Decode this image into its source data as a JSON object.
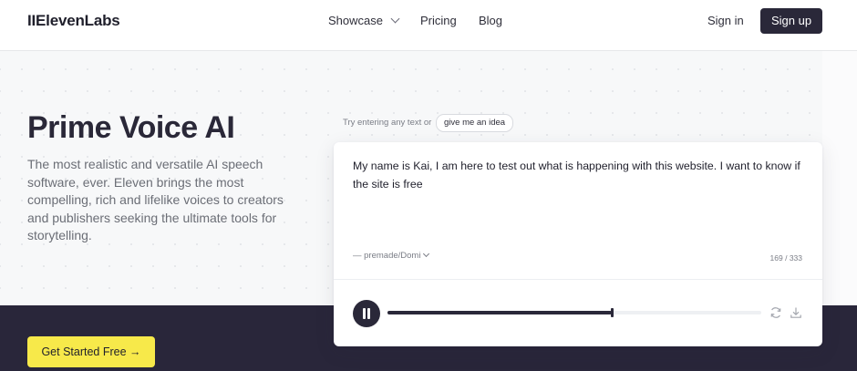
{
  "header": {
    "logo": "IIElevenLabs",
    "nav": [
      {
        "label": "Showcase",
        "has_dropdown": true
      },
      {
        "label": "Pricing"
      },
      {
        "label": "Blog"
      }
    ],
    "sign_in": "Sign in",
    "sign_up": "Sign up"
  },
  "hero": {
    "title": "Prime Voice AI",
    "subtitle": "The most realistic and versatile AI speech software, ever. Eleven brings the most compelling, rich and lifelike voices to creators and publishers seeking the ultimate tools for storytelling.",
    "cta": "Get Started Free →"
  },
  "demo": {
    "hint": "Try entering any text or",
    "idea_button": "give me an idea",
    "text": "My name is Kai, I am here to test out what is happening with this website. I want to know if the site is free",
    "voice_label": "— premade/Domi",
    "char_count": "169 / 333",
    "progress": 0.6,
    "icons": {
      "play_state": "pause-icon",
      "regenerate": "refresh-icon",
      "download": "download-icon"
    }
  },
  "colors": {
    "brand_dark": "#2a2839",
    "cta_yellow": "#f7e94a",
    "hero_bg": "#f7f8f9",
    "band": "#29263a"
  }
}
